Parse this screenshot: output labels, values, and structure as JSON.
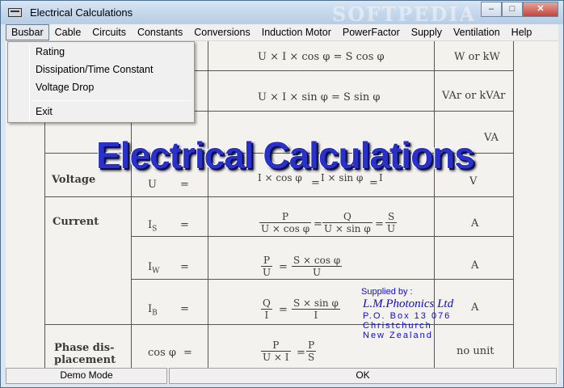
{
  "window": {
    "title": "Electrical Calculations",
    "watermark": "SOFTPEDIA",
    "controls": {
      "minimize": "–",
      "maximize": "□",
      "close": "✕"
    }
  },
  "menubar": {
    "items": [
      "Busbar",
      "Cable",
      "Circuits",
      "Constants",
      "Conversions",
      "Induction Motor",
      "PowerFactor",
      "Supply",
      "Ventilation",
      "Help"
    ]
  },
  "dropdown": {
    "items": [
      "Rating",
      "Dissipation/Time Constant",
      "Voltage Drop",
      "Exit"
    ]
  },
  "banner": {
    "text": "Electrical Calculations"
  },
  "table": {
    "row_top_formula": "U × I × cos φ = S cos φ",
    "row_top_unit": "W or kW",
    "row_reactive_formula": "U × I × sin φ = S sin φ",
    "row_reactive_unit": "VAr or kVAr",
    "row_apparent_unit": "VA",
    "voltage_label": "Voltage",
    "voltage_sym": "U",
    "voltage_eq": "=",
    "voltage_den1": "I × cos φ",
    "voltage_den2": "I × sin φ",
    "voltage_den3": "I",
    "voltage_unit": "V",
    "current_label": "Current",
    "is_sym": "I",
    "is_sub": "S",
    "is_eq": "=",
    "is_n1": "P",
    "is_d1": "U × cos φ",
    "is_n2": "Q",
    "is_d2": "U × sin φ",
    "is_n3": "S",
    "is_d3": "U",
    "is_unit": "A",
    "iw_sym": "I",
    "iw_sub": "W",
    "iw_eq": "=",
    "iw_n1": "P",
    "iw_d1": "U",
    "iw_n2": "S × cos φ",
    "iw_d2": "U",
    "iw_unit": "A",
    "ib_sym": "I",
    "ib_sub": "B",
    "ib_eq": "=",
    "ib_n1": "Q",
    "ib_d1": "I",
    "ib_n2": "S × sin φ",
    "ib_d2": "I",
    "ib_unit": "A",
    "phase_label_1": "Phase dis-",
    "phase_label_2": "placement",
    "phase_sym": "cos φ",
    "phase_eq": "=",
    "phase_n1": "P",
    "phase_d1": "U × I",
    "phase_n2": "P",
    "phase_d2": "S",
    "phase_unit": "no unit",
    "eq_sign": "="
  },
  "supplier": {
    "label": "Supplied by :",
    "company": "L.M.Photonics Ltd",
    "address1": "P.O. Box 13 076",
    "address2": "Christchurch",
    "address3": "New Zealand"
  },
  "statusbar": {
    "mode": "Demo Mode",
    "ok": "OK"
  },
  "colors": {
    "banner": "#2a31c8",
    "supplier": "#0b0bcc",
    "menu_bg": "#f0f0f0"
  }
}
